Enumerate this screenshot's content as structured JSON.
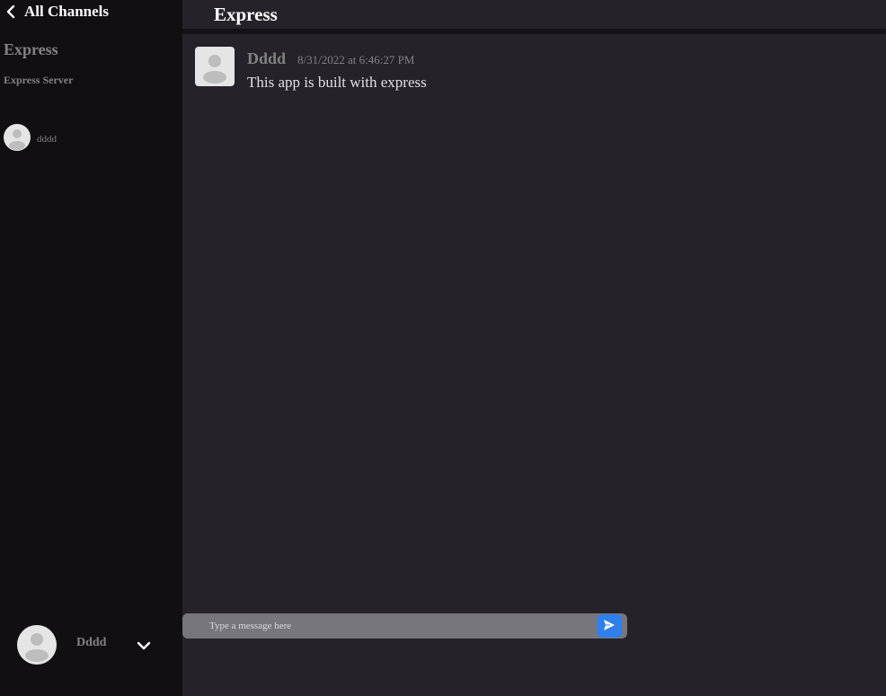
{
  "sidebar": {
    "back_label": "All Channels",
    "back_icon": "chevron-left-icon",
    "channel_name": "Express",
    "channel_description": "Express Server",
    "members": [
      {
        "name": "dddd",
        "avatar_icon": "person-icon"
      }
    ],
    "current_user": {
      "name": "Dddd",
      "avatar_icon": "person-icon",
      "menu_icon": "chevron-down-icon"
    }
  },
  "main": {
    "room_title": "Express",
    "messages": [
      {
        "author": "Dddd",
        "timestamp": "8/31/2022 at 6:46:27 PM",
        "text": "This app is built with express",
        "avatar_icon": "person-icon"
      }
    ],
    "composer": {
      "placeholder": "Type a message here",
      "value": "",
      "send_icon": "send-icon"
    }
  },
  "colors": {
    "sidebar_bg": "#120f13",
    "main_bg": "#252329",
    "accent": "#2f80ed",
    "muted_text": "#828282",
    "composer_bg": "#77767c"
  }
}
